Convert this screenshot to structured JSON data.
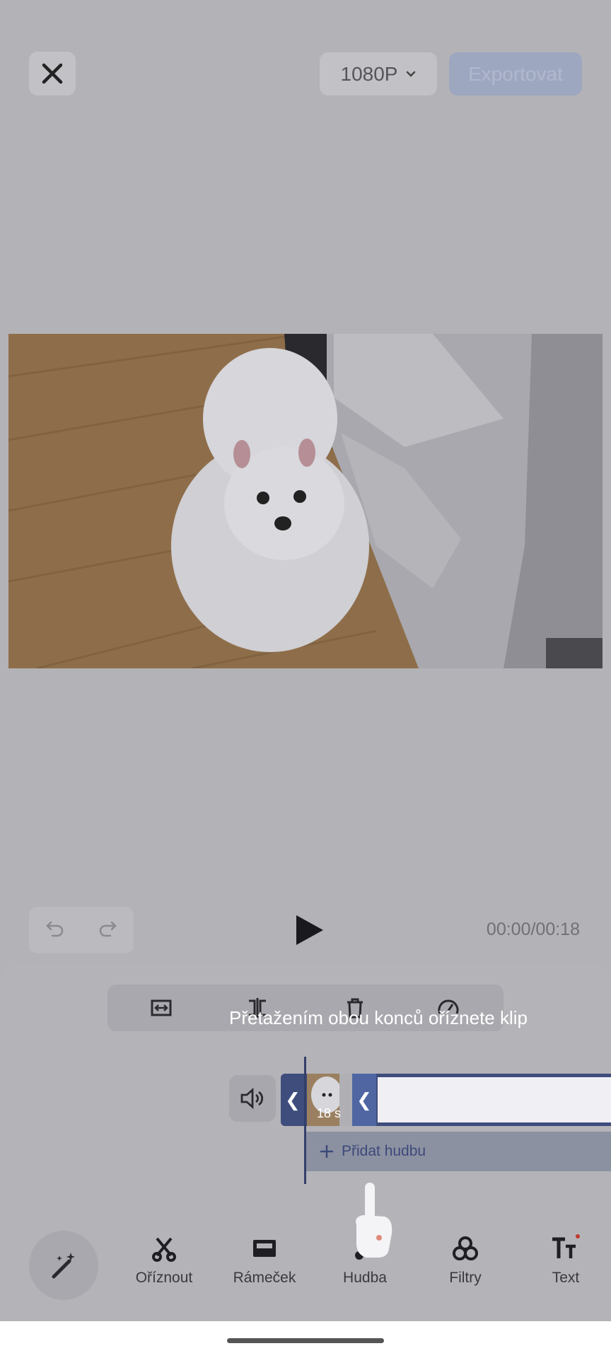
{
  "header": {
    "resolution": "1080P",
    "export_label": "Exportovat"
  },
  "player": {
    "time": "00:00/00:18"
  },
  "timeline": {
    "hint": "Přetažením obou konců oříznete klip",
    "clip_duration": "18 s",
    "add_music_label": "Přidat hudbu"
  },
  "bottom_nav": {
    "items": [
      {
        "label": "Oříznout",
        "icon": "scissors-icon"
      },
      {
        "label": "Rámeček",
        "icon": "frame-icon"
      },
      {
        "label": "Hudba",
        "icon": "music-icon"
      },
      {
        "label": "Filtry",
        "icon": "filters-icon"
      },
      {
        "label": "Text",
        "icon": "text-icon"
      }
    ]
  },
  "colors": {
    "accent": "#3e4d7c",
    "export_bg": "#9da7c0",
    "overlay_bg": "#b3b2b7"
  }
}
